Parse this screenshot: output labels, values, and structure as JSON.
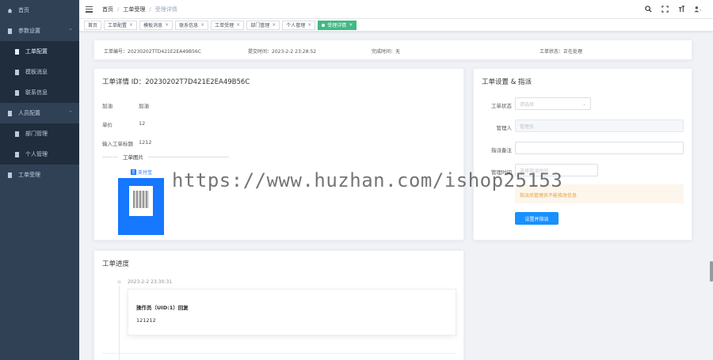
{
  "sidebar": {
    "items": [
      {
        "label": "首页",
        "icon": "home-icon"
      },
      {
        "label": "参数设置",
        "icon": "settings-icon",
        "chevron": "⌃"
      },
      {
        "label": "工单配置",
        "icon": "doc-icon"
      },
      {
        "label": "模板消息",
        "icon": "doc-icon"
      },
      {
        "label": "联系信息",
        "icon": "doc-icon"
      },
      {
        "label": "人员配置",
        "icon": "users-icon",
        "chevron": "⌃"
      },
      {
        "label": "部门管理",
        "icon": "doc-icon"
      },
      {
        "label": "个人管理",
        "icon": "doc-icon"
      },
      {
        "label": "工单受理",
        "icon": "doc-icon"
      }
    ]
  },
  "header": {
    "breadcrumb": [
      "首页",
      "工单受理",
      "受理详情"
    ],
    "icons": [
      "search-icon",
      "fullscreen-icon",
      "font-size-icon",
      "user-icon"
    ]
  },
  "tags": [
    {
      "label": "首页",
      "active": false,
      "closable": false
    },
    {
      "label": "工单配置",
      "active": false,
      "closable": true
    },
    {
      "label": "模板消息",
      "active": false,
      "closable": true
    },
    {
      "label": "联系信息",
      "active": false,
      "closable": true
    },
    {
      "label": "工单受理",
      "active": false,
      "closable": true
    },
    {
      "label": "部门管理",
      "active": false,
      "closable": true
    },
    {
      "label": "个人管理",
      "active": false,
      "closable": true
    },
    {
      "label": "受理详情",
      "active": true,
      "closable": true
    }
  ],
  "info_bar": {
    "order_no": "工单编号：20230202TTD421E2EA49B56C",
    "submit_time": "提交时间：2023-2-2 23:28:52",
    "finish_time": "完成时间：无",
    "status": "工单状态：正在处理"
  },
  "detail": {
    "title": "工单详情 ID：20230202T7D421E2EA49B56C",
    "fields": [
      {
        "label": "加油",
        "value": "加油"
      },
      {
        "label": "单价",
        "value": "12"
      },
      {
        "label": "输入工单标题",
        "value": "1212"
      }
    ],
    "image_section": "工单图片",
    "image_brand": "支付宝"
  },
  "setup": {
    "title": "工单设置 & 指派",
    "rows": [
      {
        "label": "工单状态",
        "placeholder": "请选择",
        "type": "select"
      },
      {
        "label": "管理人",
        "placeholder": "管理员",
        "type": "disabled"
      },
      {
        "label": "指派备注",
        "placeholder": "",
        "type": "input"
      },
      {
        "label": "管理时间",
        "placeholder": "选择指派时间",
        "type": "date"
      }
    ],
    "alert": "指派后管理员不能修改信息",
    "submit": "设置并指派"
  },
  "progress": {
    "title": "工单进度",
    "time": "2023-2-2 23:30:31",
    "line1": "操作员（UID:1）回复",
    "line2": "121212"
  },
  "watermark": "https://www.huzhan.com/ishop25153"
}
